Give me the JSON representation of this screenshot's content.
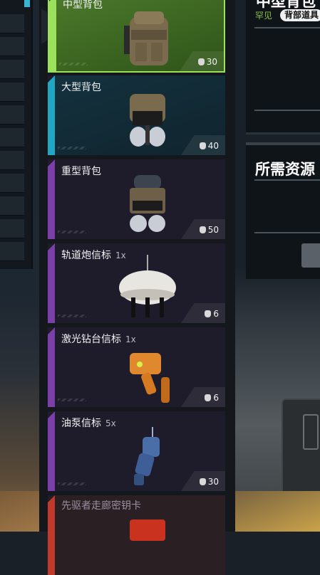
{
  "right_panel": {
    "title": "中型背包",
    "rarity": "罕见",
    "category": "背部道具",
    "resources_title": "所需资源"
  },
  "items": [
    {
      "name": "中型背包",
      "qty": "",
      "price": "30",
      "tier": "green"
    },
    {
      "name": "大型背包",
      "qty": "",
      "price": "40",
      "tier": "cyan"
    },
    {
      "name": "重型背包",
      "qty": "",
      "price": "50",
      "tier": "purple"
    },
    {
      "name": "轨道炮信标",
      "qty": "1x",
      "price": "6",
      "tier": "purple"
    },
    {
      "name": "激光钻台信标",
      "qty": "1x",
      "price": "6",
      "tier": "purple"
    },
    {
      "name": "油泵信标",
      "qty": "5x",
      "price": "30",
      "tier": "purple"
    },
    {
      "name": "先驱者走廊密钥卡",
      "qty": "",
      "price": "",
      "tier": "red"
    }
  ],
  "colors": {
    "green_accent": "#9be15a",
    "cyan_accent": "#1fa7c4",
    "purple_accent": "#7a3fa8",
    "red_accent": "#c0392b"
  }
}
